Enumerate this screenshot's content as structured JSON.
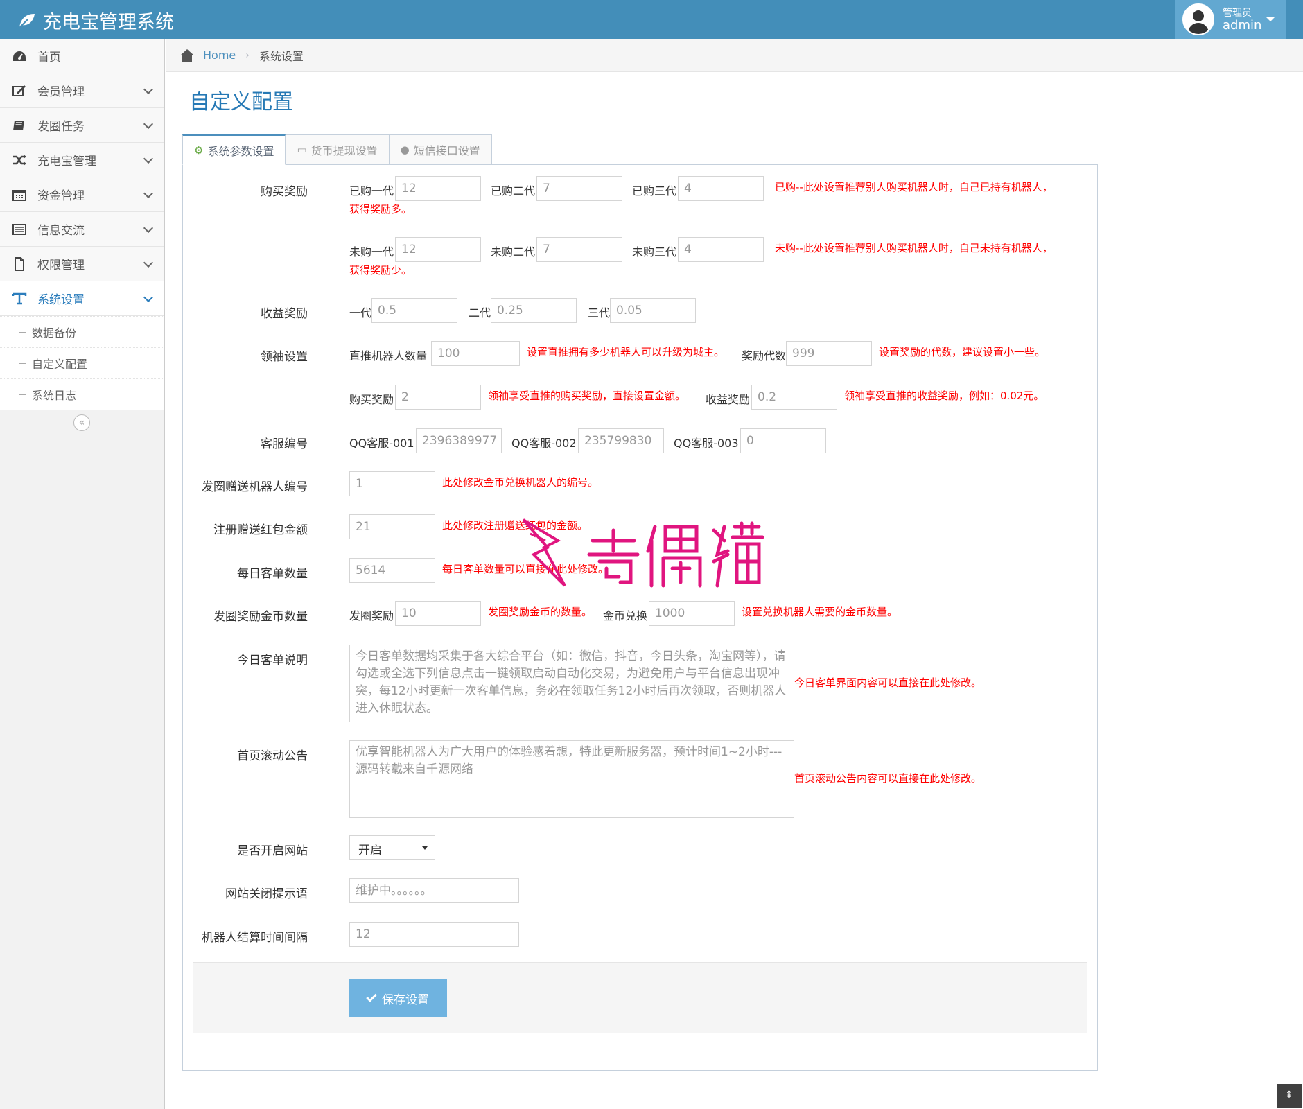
{
  "app": {
    "title": "充电宝管理系统"
  },
  "user": {
    "role": "管理员",
    "name": "admin"
  },
  "sidebar": {
    "items": [
      {
        "label": "首页",
        "icon": "tachometer-icon"
      },
      {
        "label": "会员管理",
        "icon": "edit-icon"
      },
      {
        "label": "发圈任务",
        "icon": "book-icon"
      },
      {
        "label": "充电宝管理",
        "icon": "random-icon"
      },
      {
        "label": "资金管理",
        "icon": "calendar-icon"
      },
      {
        "label": "信息交流",
        "icon": "list-icon"
      },
      {
        "label": "权限管理",
        "icon": "file-icon"
      },
      {
        "label": "系统设置",
        "icon": "text-icon"
      }
    ],
    "sub_items": [
      {
        "label": "数据备份"
      },
      {
        "label": "自定义配置"
      },
      {
        "label": "系统日志"
      }
    ],
    "collapse_glyph": "«"
  },
  "breadcrumb": {
    "home": "Home",
    "separator": "›",
    "current": "系统设置"
  },
  "page": {
    "title": "自定义配置"
  },
  "tabs": [
    {
      "label": "系统参数设置",
      "icon": "cogs-icon",
      "active": true
    },
    {
      "label": "货币提现设置",
      "icon": "credit-card-icon",
      "active": false
    },
    {
      "label": "短信接口设置",
      "icon": "user-icon",
      "active": false
    }
  ],
  "form": {
    "buy_reward": {
      "label": "购买奖励",
      "bought": {
        "l1": "已购一代",
        "v1": "12",
        "l2": "已购二代",
        "v2": "7",
        "l3": "已购三代",
        "v3": "4",
        "hint1": "已购--此处设置推荐别人购买机器人时，自己已持有机器人，",
        "hint2": "获得奖励多。"
      },
      "unbought": {
        "l1": "未购一代",
        "v1": "12",
        "l2": "未购二代",
        "v2": "7",
        "l3": "未购三代",
        "v3": "4",
        "hint1": "未购--此处设置推荐别人购买机器人时，自己未持有机器人，",
        "hint2": "获得奖励少。"
      }
    },
    "income_reward": {
      "label": "收益奖励",
      "l1": "一代",
      "v1": "0.5",
      "l2": "二代",
      "v2": "0.25",
      "l3": "三代",
      "v3": "0.05"
    },
    "leader": {
      "label": "领袖设置",
      "direct_label": "直推机器人数量",
      "direct_value": "100",
      "direct_hint": "设置直推拥有多少机器人可以升级为城主。",
      "gen_label": "奖励代数",
      "gen_value": "999",
      "gen_hint": "设置奖励的代数，建议设置小一些。",
      "buy_label": "购买奖励",
      "buy_value": "2",
      "buy_hint": "领袖享受直推的购买奖励，直接设置金额。",
      "income_label": "收益奖励",
      "income_value": "0.2",
      "income_hint": "领袖享受直推的收益奖励，例如：0.02元。"
    },
    "service": {
      "label": "客服编号",
      "l1": "QQ客服-001",
      "v1": "2396389977",
      "l2": "QQ客服-002",
      "v2": "235799830",
      "l3": "QQ客服-003",
      "v3": "0"
    },
    "gift_robot": {
      "label": "发圈赠送机器人编号",
      "value": "1",
      "hint": "此处修改金币兑换机器人的编号。"
    },
    "register_gift": {
      "label": "注册赠送红包金额",
      "value": "21",
      "hint": "此处修改注册赠送红包的金额。"
    },
    "daily_orders": {
      "label": "每日客单数量",
      "value": "5614",
      "hint": "每日客单数量可以直接在此处修改。"
    },
    "post_coins": {
      "label": "发圈奖励金币数量",
      "l1": "发圈奖励",
      "v1": "10",
      "hint1": "发圈奖励金币的数量。",
      "l2": "金币兑换",
      "v2": "1000",
      "hint2": "设置兑换机器人需要的金币数量。"
    },
    "today_desc": {
      "label": "今日客单说明",
      "value": "今日客单数据均采集于各大综合平台（如：微信，抖音，今日头条，淘宝网等），请勾选或全选下列信息点击一键领取启动自动化交易，为避免用户与平台信息出现冲突，每12小时更新一次客单信息，务必在领取任务12小时后再次领取，否则机器人进入休眠状态。",
      "hint": "今日客单界面内容可以直接在此处修改。"
    },
    "notice": {
      "label": "首页滚动公告",
      "value": "优享智能机器人为广大用户的体验感着想，特此更新服务器，预计时间1~2小时---源码转载来自千源网络",
      "hint": "首页滚动公告内容可以直接在此处修改。"
    },
    "site_open": {
      "label": "是否开启网站",
      "value": "开启"
    },
    "close_tip": {
      "label": "网站关闭提示语",
      "placeholder": "维护中。。。。。。"
    },
    "settle": {
      "label": "机器人结算时间间隔",
      "value": "12"
    },
    "save_label": "保存设置"
  },
  "to_top_glyph": "⇞",
  "watermark_text": "奇偶猫"
}
